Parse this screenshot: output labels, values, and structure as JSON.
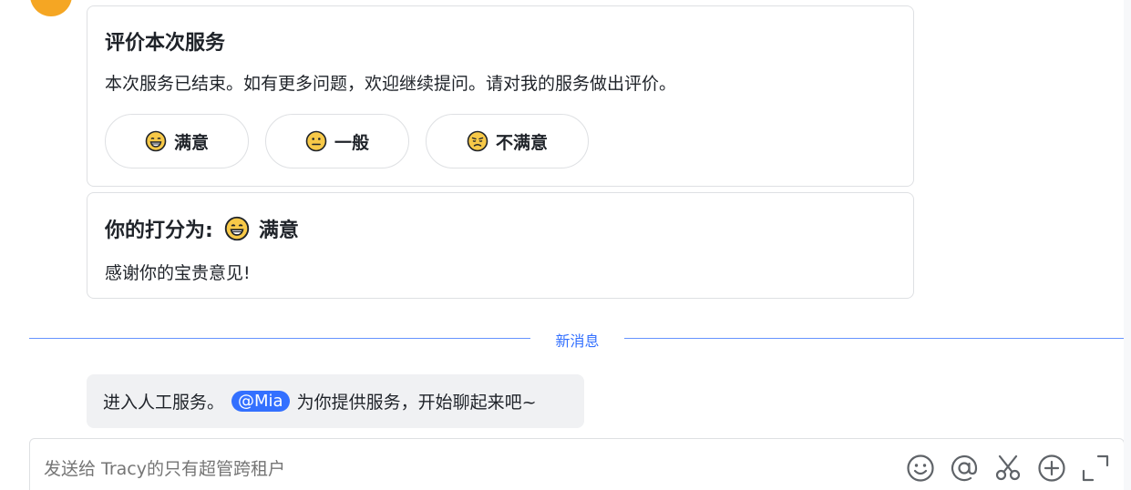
{
  "rating_card": {
    "title": "评价本次服务",
    "text": "本次服务已结束。如有更多问题，欢迎继续提问。请对我的服务做出评价。",
    "options": [
      {
        "label": "满意",
        "icon": "grin-emoji-icon"
      },
      {
        "label": "一般",
        "icon": "neutral-emoji-icon"
      },
      {
        "label": "不满意",
        "icon": "disappointed-emoji-icon"
      }
    ]
  },
  "result_card": {
    "title_prefix": "你的打分为:",
    "rating": "满意",
    "text": "感谢你的宝贵意见!"
  },
  "divider": {
    "label": "新消息"
  },
  "system_message": {
    "before": "进入人工服务。",
    "mention": "@Mia",
    "after": "为你提供服务，开始聊起来吧~"
  },
  "composer": {
    "placeholder": "发送给 Tracy的只有超管跨租户",
    "tools": [
      "emoji-icon",
      "at-icon",
      "scissors-icon",
      "plus-circle-icon",
      "expand-icon"
    ]
  },
  "colors": {
    "accent": "#3370ff",
    "emoji": "#f7c948",
    "avatar": "#f5a623"
  }
}
